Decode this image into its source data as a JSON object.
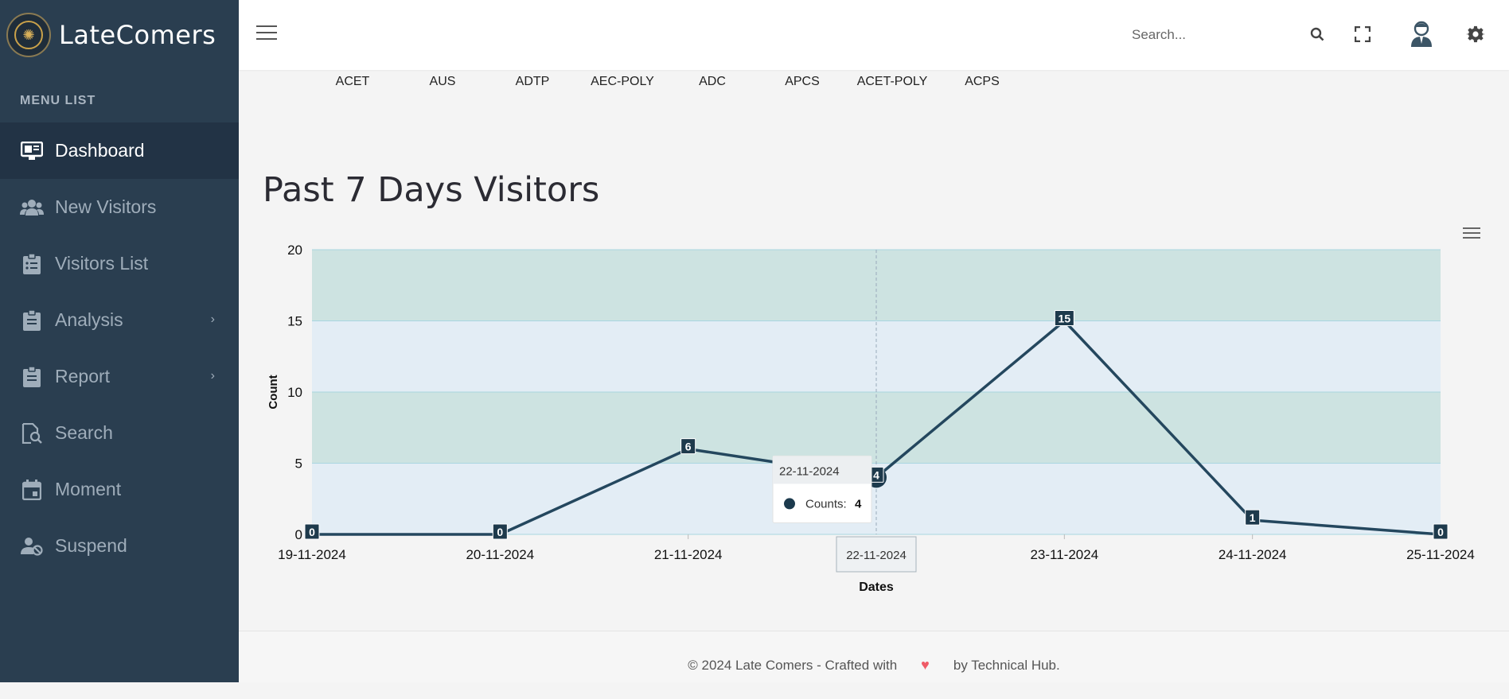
{
  "app": {
    "brand": "LateComers"
  },
  "sidebar": {
    "menu_title": "MENU LIST",
    "items": [
      {
        "label": "Dashboard",
        "icon": "monitor-icon",
        "active": true
      },
      {
        "label": "New Visitors",
        "icon": "users-icon"
      },
      {
        "label": "Visitors List",
        "icon": "clipboard-list-icon"
      },
      {
        "label": "Analysis",
        "icon": "clipboard-icon",
        "submenu": true
      },
      {
        "label": "Report",
        "icon": "clipboard-icon",
        "submenu": true
      },
      {
        "label": "Search",
        "icon": "file-search-icon"
      },
      {
        "label": "Moment",
        "icon": "calendar-icon"
      },
      {
        "label": "Suspend",
        "icon": "user-block-icon"
      }
    ]
  },
  "topbar": {
    "search_placeholder": "Search..."
  },
  "main": {
    "categories": [
      "ACET",
      "AUS",
      "ADTP",
      "AEC-POLY",
      "ADC",
      "APCS",
      "ACET-POLY",
      "ACPS"
    ],
    "title": "Past 7 Days Visitors"
  },
  "chart_data": {
    "type": "line",
    "x": [
      "19-11-2024",
      "20-11-2024",
      "21-11-2024",
      "22-11-2024",
      "23-11-2024",
      "24-11-2024",
      "25-11-2024"
    ],
    "series": [
      {
        "name": "Counts",
        "values": [
          0,
          0,
          6,
          4,
          15,
          1,
          0
        ]
      }
    ],
    "xlabel": "Dates",
    "ylabel": "Count",
    "ylim": [
      0,
      20
    ],
    "yticks": [
      0,
      5,
      10,
      15,
      20
    ],
    "grid": true,
    "plot_bands": [
      "#e3edf5",
      "#cde3e1"
    ],
    "line_color": "#24475e",
    "tooltip": {
      "date": "22-11-2024",
      "label": "Counts:",
      "value": "4"
    },
    "crosshair_label": "22-11-2024"
  },
  "footer": {
    "text_left": "© 2024 Late Comers - Crafted with",
    "text_right": "by Technical Hub."
  }
}
